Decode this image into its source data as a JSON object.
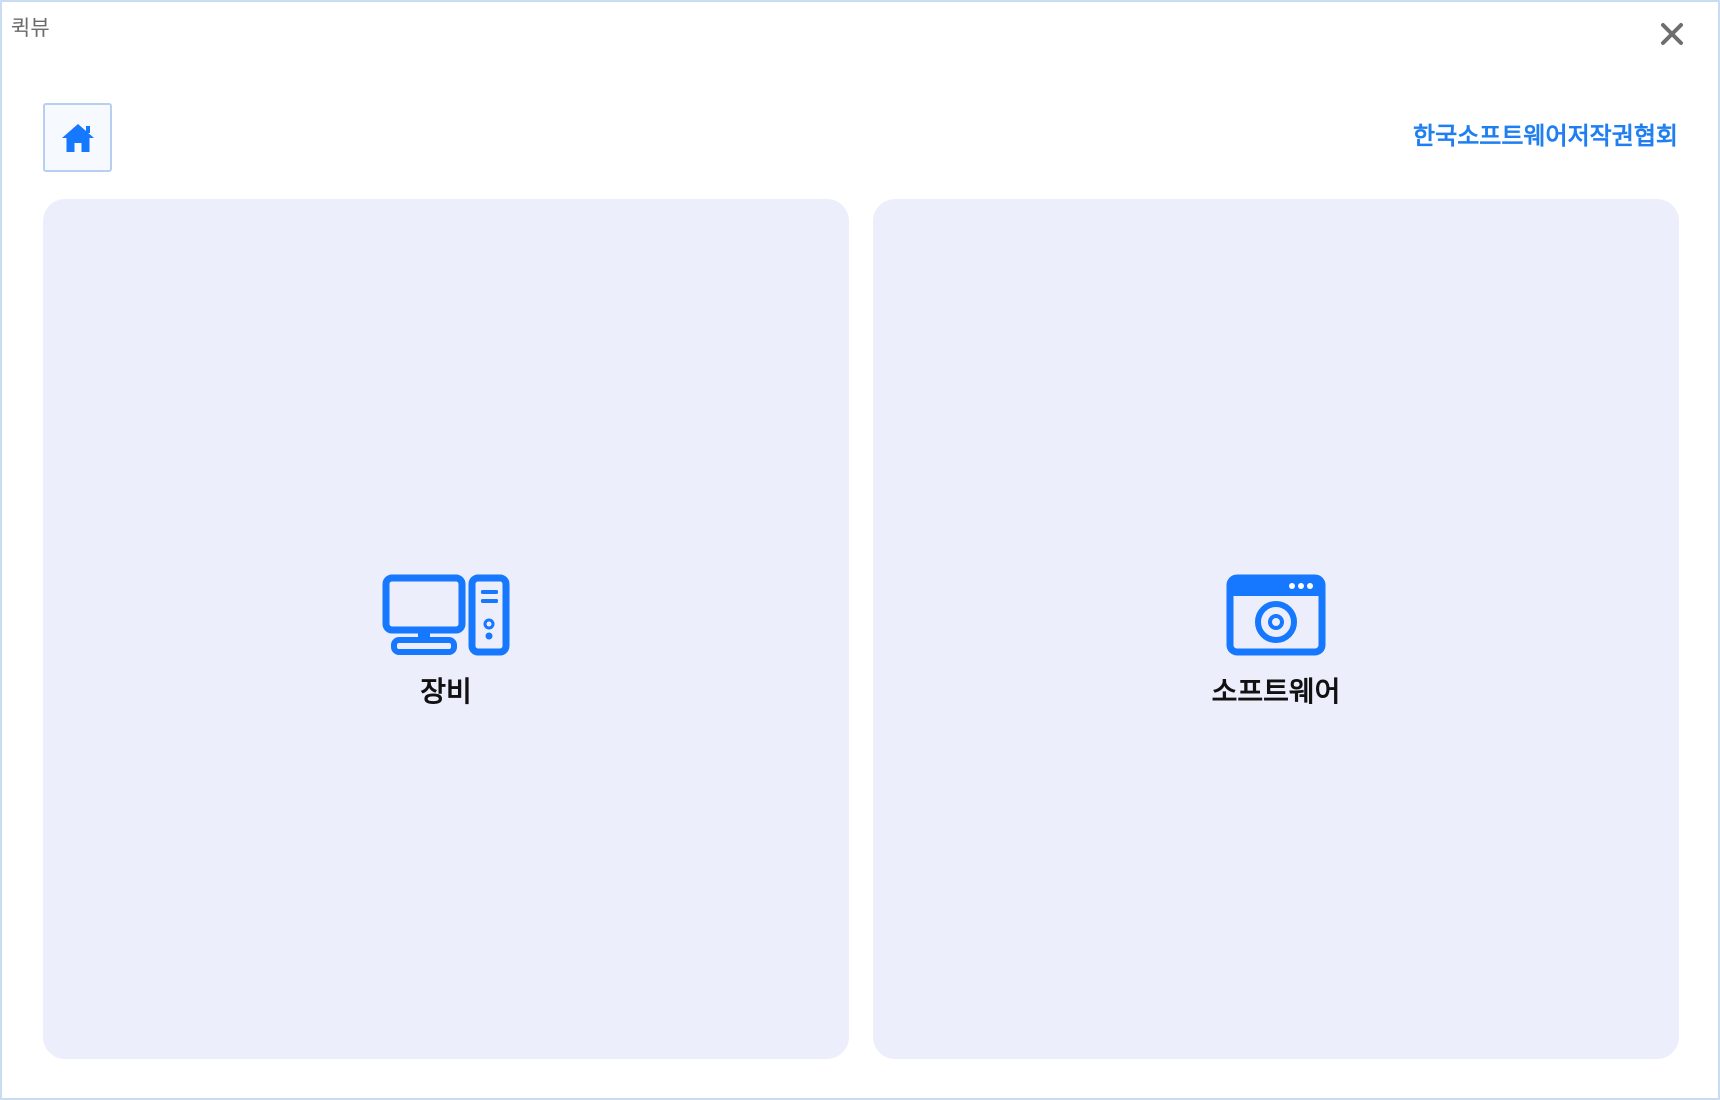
{
  "window": {
    "title": "퀵뷰",
    "close_icon": "close-icon"
  },
  "header": {
    "home_icon": "home-icon",
    "org_link": "한국소프트웨어저작권협회"
  },
  "cards": [
    {
      "label": "장비",
      "icon": "desktop-computer-icon"
    },
    {
      "label": "소프트웨어",
      "icon": "software-disc-window-icon"
    }
  ],
  "colors": {
    "accent": "#1f7ff0",
    "icon_blue": "#1677ff",
    "card_bg": "#eceefc",
    "window_border": "#c9dcf2",
    "title_text": "#6b6b6b",
    "close_icon": "#6e6e6e"
  }
}
